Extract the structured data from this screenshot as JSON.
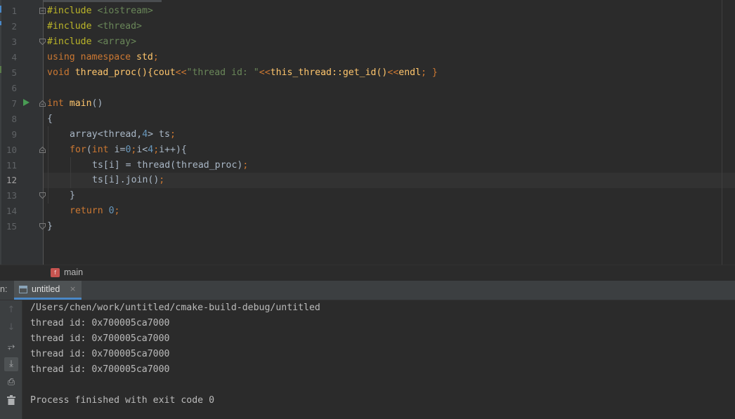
{
  "editor": {
    "line_numbers": [
      "1",
      "2",
      "3",
      "4",
      "5",
      "6",
      "7",
      "8",
      "9",
      "10",
      "11",
      "12",
      "13",
      "14",
      "15"
    ],
    "current_line": "12",
    "lines": {
      "l1": {
        "a": "#include ",
        "b": "<iostream>"
      },
      "l2": {
        "a": "#include ",
        "b": "<thread>"
      },
      "l3": {
        "a": "#include ",
        "b": "<array>"
      },
      "l4": {
        "a": "using namespace ",
        "b": "std",
        "c": ";"
      },
      "l5": {
        "a": "void ",
        "b": "thread_proc",
        "c": "(){",
        "d": "cout",
        "e": "<<",
        "f": "\"thread id: \"",
        "g": "<<",
        "h": "this_thread::get_id()",
        "i": "<<",
        "j": "endl",
        "k": "; }"
      },
      "l7": {
        "a": "int ",
        "b": "main",
        "c": "()"
      },
      "l8": {
        "a": "{"
      },
      "l9": {
        "a": "array<thread,",
        "b": "4",
        "c": "> ts",
        "d": ";"
      },
      "l10": {
        "a": "for",
        "b": "(",
        "c": "int ",
        "d": "i=",
        "e": "0",
        "f": ";",
        "g": "i<",
        "h": "4",
        "i": ";",
        "j": "i++){"
      },
      "l11": {
        "a": "ts[i] = thread(thread_proc)",
        "b": ";"
      },
      "l12": {
        "a": "ts[i].join()",
        "b": ";"
      },
      "l13": {
        "a": "}"
      },
      "l14": {
        "a": "return ",
        "b": "0",
        "c": ";"
      },
      "l15": {
        "a": "}"
      }
    }
  },
  "breadcrumb": {
    "badge": "f",
    "label": "main",
    "icon": "function-icon"
  },
  "run_window": {
    "prefix": "n:",
    "tab_label": "untitled",
    "tab_close": "×",
    "toolbar": [
      {
        "icon": "arrow-up-icon",
        "glyph": "↑"
      },
      {
        "icon": "arrow-down-icon",
        "glyph": "↓"
      },
      {
        "icon": "soft-wrap-icon",
        "glyph": "⥅"
      },
      {
        "icon": "scroll-to-end-icon",
        "glyph": "⤓"
      },
      {
        "icon": "print-icon",
        "glyph": "⎙"
      },
      {
        "icon": "trash-icon",
        "glyph": "🗑"
      }
    ],
    "console_lines": [
      "/Users/chen/work/untitled/cmake-build-debug/untitled",
      "thread id: 0x700005ca7000",
      "thread id: 0x700005ca7000",
      "thread id: 0x700005ca7000",
      "thread id: 0x700005ca7000",
      "",
      "Process finished with exit code 0"
    ]
  },
  "colors": {
    "background": "#2b2b2b",
    "keyword": "#cc7832",
    "preprocessor": "#bbb529",
    "string": "#6a8759",
    "function": "#ffc66d",
    "number": "#6897bb",
    "text": "#a9b7c6",
    "run_icon": "#499c54",
    "accent": "#4a88c7"
  }
}
